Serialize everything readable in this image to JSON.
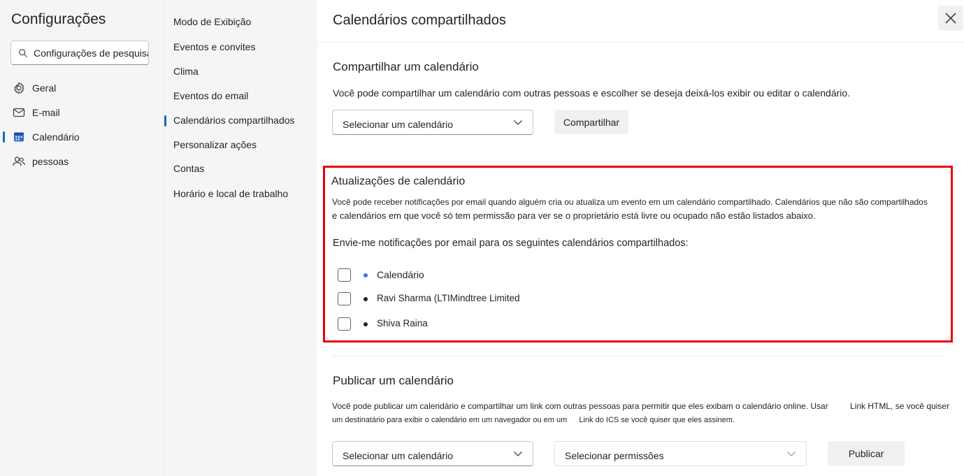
{
  "sidebar": {
    "title": "Configurações",
    "search_placeholder": "Configurações de pesquisa",
    "items": [
      {
        "label": "Geral",
        "icon": "gear-icon"
      },
      {
        "label": "E-mail",
        "icon": "mail-icon"
      },
      {
        "label": "Calendário",
        "icon": "calendar-icon",
        "selected": true
      },
      {
        "label": "pessoas",
        "icon": "people-icon"
      }
    ]
  },
  "submenu": {
    "items": [
      {
        "label": "Modo de Exibição"
      },
      {
        "label": "Eventos e convites"
      },
      {
        "label": "Clima"
      },
      {
        "label": "Eventos do email"
      },
      {
        "label": "Calendários compartilhados",
        "selected": true
      },
      {
        "label": "Personalizar ações"
      },
      {
        "label": "Contas"
      },
      {
        "label": "Horário e local de trabalho"
      }
    ]
  },
  "main": {
    "title": "Calendários compartilhados",
    "close_icon": "close-icon",
    "share": {
      "heading": "Compartilhar um calendário",
      "description": "Você pode compartilhar um calendário com outras pessoas e escolher se deseja deixá-los exibir ou editar o calendário.",
      "select_label": "Selecionar um calendário",
      "button_label": "Compartilhar"
    },
    "updates": {
      "heading": "Atualizações de calendário",
      "description_line1": "Você pode receber notificações por email quando alguém cria ou atualiza um evento em um calendário compartilhado. Calendários que não são compartilhados",
      "description_line2": "e calendários em que você só tem permissão para ver se o proprietário está livre ou ocupado não estão listados abaixo.",
      "prompt": "Envie-me notificações por email para os seguintes calendários compartilhados:",
      "calendars": [
        {
          "name": "Calendário",
          "color": "#4f6bed",
          "checked": false
        },
        {
          "name": "Ravi Sharma (LTIMindtree Limited",
          "color": "#242424",
          "checked": false
        },
        {
          "name": "Shiva Raina",
          "color": "#242424",
          "checked": false
        }
      ]
    },
    "publish": {
      "heading": "Publicar um calendário",
      "line1_text": "Você pode publicar um calendário e compartilhar um link com outras pessoas para permitir que eles exibam o calendário online. Usar",
      "line1_link": "Link HTML, se você quiser",
      "line2_text": "um destinatário para exibir o calendário em um navegador ou em um",
      "line2_link": "Link do ICS se você quiser que eles assinem.",
      "select_calendar_label": "Selecionar um calendário",
      "select_permissions_label": "Selecionar permissões",
      "button_label": "Publicar"
    }
  }
}
